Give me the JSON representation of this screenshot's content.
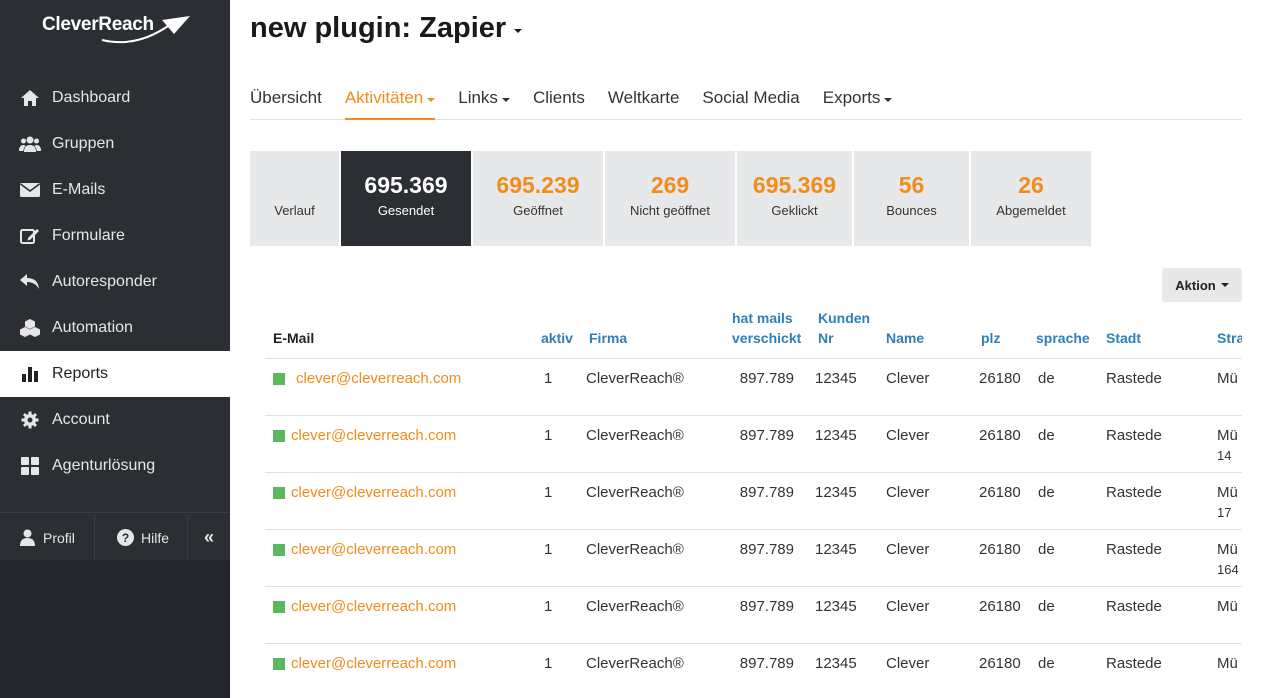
{
  "app": {
    "logo": "CleverReach"
  },
  "sidebar": {
    "items": [
      {
        "label": "Dashboard",
        "icon": "home-icon"
      },
      {
        "label": "Gruppen",
        "icon": "users-icon"
      },
      {
        "label": "E-Mails",
        "icon": "envelope-icon"
      },
      {
        "label": "Formulare",
        "icon": "edit-icon"
      },
      {
        "label": "Autoresponder",
        "icon": "reply-icon"
      },
      {
        "label": "Automation",
        "icon": "cubes-icon"
      },
      {
        "label": "Reports",
        "icon": "bar-chart-icon",
        "active": true
      },
      {
        "label": "Account",
        "icon": "gear-icon"
      },
      {
        "label": "Agenturlösung",
        "icon": "grid-icon"
      }
    ],
    "profile": "Profil",
    "help": "Hilfe",
    "collapse": "«"
  },
  "page": {
    "title": "new plugin: Zapier"
  },
  "tabs": [
    {
      "label": "Übersicht",
      "dropdown": false
    },
    {
      "label": "Aktivitäten",
      "dropdown": true,
      "active": true
    },
    {
      "label": "Links",
      "dropdown": true
    },
    {
      "label": "Clients",
      "dropdown": false
    },
    {
      "label": "Weltkarte",
      "dropdown": false
    },
    {
      "label": "Social Media",
      "dropdown": false
    },
    {
      "label": "Exports",
      "dropdown": true
    }
  ],
  "stats": [
    {
      "value": "",
      "label": "Verlauf"
    },
    {
      "value": "695.369",
      "label": "Gesendet",
      "active": true
    },
    {
      "value": "695.239",
      "label": "Geöffnet"
    },
    {
      "value": "269",
      "label": "Nicht geöffnet"
    },
    {
      "value": "695.369",
      "label": "Geklickt"
    },
    {
      "value": "56",
      "label": "Bounces"
    },
    {
      "value": "26",
      "label": "Abgemeldet"
    }
  ],
  "action": {
    "label": "Aktion"
  },
  "table": {
    "headers": {
      "email": "E-Mail",
      "aktiv": "aktiv",
      "firma": "Firma",
      "mails_1": "hat mails",
      "mails_2": "verschickt",
      "kunden_1": "Kunden",
      "kunden_2": "Nr",
      "name": "Name",
      "plz": "plz",
      "sprache": "sprache",
      "stadt": "Stadt",
      "strasse": "Stra"
    },
    "rows": [
      {
        "email": "clever@cleverreach.com",
        "aktiv": "1",
        "firma": "CleverReach®",
        "mails": "897.789",
        "kunden": "12345",
        "name": "Clever",
        "plz": "26180",
        "sprache": "de",
        "stadt": "Rastede",
        "strasse": "Mü",
        "strasse2": ""
      },
      {
        "email": "clever@cleverreach.com",
        "aktiv": "1",
        "firma": "CleverReach®",
        "mails": "897.789",
        "kunden": "12345",
        "name": "Clever",
        "plz": "26180",
        "sprache": "de",
        "stadt": "Rastede",
        "strasse": "Mü",
        "strasse2": "14"
      },
      {
        "email": "clever@cleverreach.com",
        "aktiv": "1",
        "firma": "CleverReach®",
        "mails": "897.789",
        "kunden": "12345",
        "name": "Clever",
        "plz": "26180",
        "sprache": "de",
        "stadt": "Rastede",
        "strasse": "Mü",
        "strasse2": "17"
      },
      {
        "email": "clever@cleverreach.com",
        "aktiv": "1",
        "firma": "CleverReach®",
        "mails": "897.789",
        "kunden": "12345",
        "name": "Clever",
        "plz": "26180",
        "sprache": "de",
        "stadt": "Rastede",
        "strasse": "Mü",
        "strasse2": "164"
      },
      {
        "email": "clever@cleverreach.com",
        "aktiv": "1",
        "firma": "CleverReach®",
        "mails": "897.789",
        "kunden": "12345",
        "name": "Clever",
        "plz": "26180",
        "sprache": "de",
        "stadt": "Rastede",
        "strasse": "Mü",
        "strasse2": ""
      },
      {
        "email": "clever@cleverreach.com",
        "aktiv": "1",
        "firma": "CleverReach®",
        "mails": "897.789",
        "kunden": "12345",
        "name": "Clever",
        "plz": "26180",
        "sprache": "de",
        "stadt": "Rastede",
        "strasse": "Mü",
        "strasse2": ""
      }
    ]
  },
  "colors": {
    "accent": "#f28c1a",
    "sidebar": "#2b2e33",
    "link": "#2f7fb9",
    "status_active": "#5cb85c"
  }
}
